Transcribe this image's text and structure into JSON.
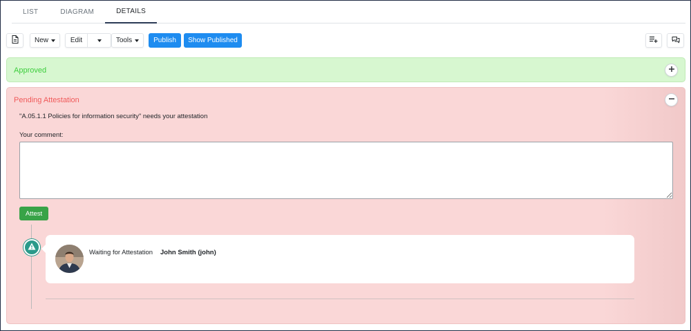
{
  "tabs": [
    {
      "label": "LIST"
    },
    {
      "label": "DIAGRAM"
    },
    {
      "label": "DETAILS",
      "active": true
    }
  ],
  "toolbar": {
    "new_label": "New",
    "edit_label": "Edit",
    "tools_label": "Tools",
    "publish_label": "Publish",
    "show_published_label": "Show Published"
  },
  "approved": {
    "title": "Approved",
    "expand_icon": "plus-icon"
  },
  "pending": {
    "title": "Pending Attestation",
    "collapse_icon": "minus-icon",
    "message": "\"A.05.1.1 Policies for information security\" needs your attestation",
    "comment_label": "Your comment:",
    "comment_value": "",
    "attest_label": "Attest"
  },
  "timeline": {
    "icon": "warning-icon",
    "status": "Waiting for Attestation",
    "user": "John Smith (john)"
  },
  "colors": {
    "primary": "#1e8cf0",
    "success": "#38a347",
    "approved_bg": "#d7f7d0",
    "approved_text": "#3ccd3c",
    "pending_bg": "#fad7d7",
    "pending_text": "#f05a5a",
    "timeline_icon": "#2a9a8a"
  }
}
